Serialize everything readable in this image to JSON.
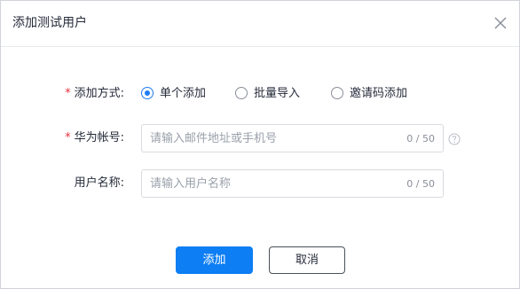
{
  "dialog": {
    "title": "添加测试用户",
    "close_icon": "close-icon"
  },
  "form": {
    "method": {
      "required": "*",
      "label": "添加方式:",
      "options": [
        {
          "label": "单个添加",
          "checked": true
        },
        {
          "label": "批量导入",
          "checked": false
        },
        {
          "label": "邀请码添加",
          "checked": false
        }
      ]
    },
    "account": {
      "required": "*",
      "label": "华为帐号:",
      "placeholder": "请输入邮件地址或手机号",
      "counter": "0 / 50",
      "help_icon": "question-circle-icon"
    },
    "username": {
      "label": "用户名称:",
      "placeholder": "请输入用户名称",
      "counter": "0 / 50"
    }
  },
  "footer": {
    "add_label": "添加",
    "cancel_label": "取消"
  },
  "colors": {
    "accent": "#0d7ef4",
    "required": "#e5323c",
    "border": "#d8dbe0"
  }
}
